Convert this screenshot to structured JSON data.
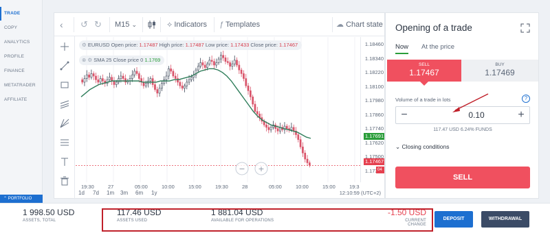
{
  "left_nav": {
    "items": [
      {
        "label": "TRADE",
        "active": true
      },
      {
        "label": "COPY",
        "active": false
      },
      {
        "label": "ANALYTICS",
        "active": false
      },
      {
        "label": "PROFILE",
        "active": false
      },
      {
        "label": "FINANCE",
        "active": false
      },
      {
        "label": "METATRADER",
        "active": false
      },
      {
        "label": "AFFILIATE",
        "active": false
      }
    ],
    "portfolio_label": "PORTFOLIO"
  },
  "toolbar": {
    "timeframe": "M15",
    "indicators_label": "Indicators",
    "templates_label": "Templates",
    "chart_state_label": "Chart state"
  },
  "legend_main": {
    "symbol": "EURUSD",
    "open_label": "Open price:",
    "open": "1.17487",
    "high_label": "High price:",
    "high": "1.17487",
    "low_label": "Low price:",
    "low": "1.17433",
    "close_label": "Close price:",
    "close": "1.17467"
  },
  "legend_sma": {
    "text": "SMA 25 Close price 0",
    "value": "1.1769"
  },
  "y_axis_ticks": [
    "1.18460",
    "1.18340",
    "1.18220",
    "1.18100",
    "1.17980",
    "1.17860",
    "1.17740",
    "1.17620",
    "1.17500",
    "1.17380"
  ],
  "price_tags": {
    "sma": "1.17691",
    "current": "1.17467",
    "current_suffix": "04"
  },
  "x_axis_ticks": [
    "19:30",
    "27",
    "05:00",
    "10:00",
    "15:00",
    "19:30",
    "28",
    "05:00",
    "10:00",
    "15:00",
    "19:3"
  ],
  "timeframes": [
    "1d",
    "7d",
    "1m",
    "3m",
    "6m",
    "1y"
  ],
  "clock": "12:10:59 (UTC+2)",
  "order": {
    "title": "Opening of a trade",
    "tabs": [
      "Now",
      "At the price"
    ],
    "sell_label": "SELL",
    "sell_price": "1.17467",
    "buy_label": "BUY",
    "buy_price": "1.17469",
    "volume_label": "Volume of a trade in lots",
    "help": "?",
    "volume": "0.10",
    "minus": "−",
    "plus": "+",
    "funds_usd": "117.47 USD",
    "funds_pct": "6.24% FUNDS",
    "conditions_label": "Closing conditions",
    "submit_label": "SELL"
  },
  "bottom": {
    "assets_total": "1 998.50 USD",
    "assets_total_caption": "ASSETS, TOTAL",
    "assets_used": "117.46 USD",
    "assets_used_caption": "ASSETS USED",
    "available": "1 881.04 USD",
    "available_caption": "AVAILABLE FOR OPERATIONS",
    "current_change": "-1.50 USD",
    "current_change_caption": "CURRENT CHANGE",
    "deposit_label": "DEPOSIT",
    "withdrawal_label": "WITHDRAWAL"
  },
  "chart_data": {
    "type": "candlestick",
    "y_range": [
      1.1733,
      1.1852
    ],
    "x_ticks": [
      "19:30",
      "27",
      "05:00",
      "10:00",
      "15:00",
      "19:30",
      "28",
      "05:00",
      "10:00",
      "15:00",
      "19:3"
    ],
    "ohlc_close": [
      1.1815,
      1.1818,
      1.1821,
      1.1819,
      1.1822,
      1.182,
      1.1817,
      1.1815,
      1.1818,
      1.1816,
      1.1814,
      1.1817,
      1.1819,
      1.1816,
      1.1813,
      1.1815,
      1.1818,
      1.182,
      1.1818,
      1.1815,
      1.1816,
      1.1818,
      1.1821,
      1.1824,
      1.1822,
      1.1818,
      1.1815,
      1.1812,
      1.1814,
      1.1816,
      1.1818,
      1.1813,
      1.1809,
      1.1806,
      1.181,
      1.1814,
      1.1817,
      1.182,
      1.1826,
      1.1824,
      1.182,
      1.1818,
      1.1815,
      1.1812,
      1.181,
      1.1812,
      1.1815,
      1.1817,
      1.1819,
      1.1821,
      1.1825,
      1.1828,
      1.1831,
      1.1829,
      1.1827,
      1.183,
      1.1833,
      1.1832,
      1.1829,
      1.1831,
      1.1834,
      1.1837,
      1.1835,
      1.1832,
      1.1831,
      1.1828,
      1.183,
      1.1833,
      1.1829,
      1.1825,
      1.1822,
      1.1818,
      1.1812,
      1.1808,
      1.1803,
      1.1797,
      1.1791,
      1.1789,
      1.1786,
      1.1783,
      1.178,
      1.1778,
      1.1776,
      1.1778,
      1.178,
      1.1777,
      1.1775,
      1.1778,
      1.1776,
      1.1779,
      1.1777,
      1.1776,
      1.1778,
      1.1775,
      1.1772,
      1.1768,
      1.1762,
      1.1757,
      1.1752,
      1.1749,
      1.1747
    ],
    "sma25": [
      1.1803,
      1.1806,
      1.1809,
      1.1811,
      1.1813,
      1.1814,
      1.1815,
      1.1816,
      1.1816,
      1.1816,
      1.1816,
      1.1816,
      1.1816,
      1.1816,
      1.1815,
      1.1815,
      1.1815,
      1.1815,
      1.1816,
      1.1816,
      1.1816,
      1.1817,
      1.1817,
      1.1818,
      1.1819,
      1.182,
      1.1822,
      1.1824,
      1.1825,
      1.1826,
      1.1826,
      1.1825,
      1.1823,
      1.182,
      1.1816,
      1.1811,
      1.1806,
      1.1801,
      1.1796,
      1.1791,
      1.1787,
      1.1784,
      1.1782,
      1.178,
      1.1779,
      1.1778,
      1.1777,
      1.1776,
      1.1775,
      1.1774,
      1.1772,
      1.177,
      1.1769
    ],
    "current_price": 1.17467
  }
}
